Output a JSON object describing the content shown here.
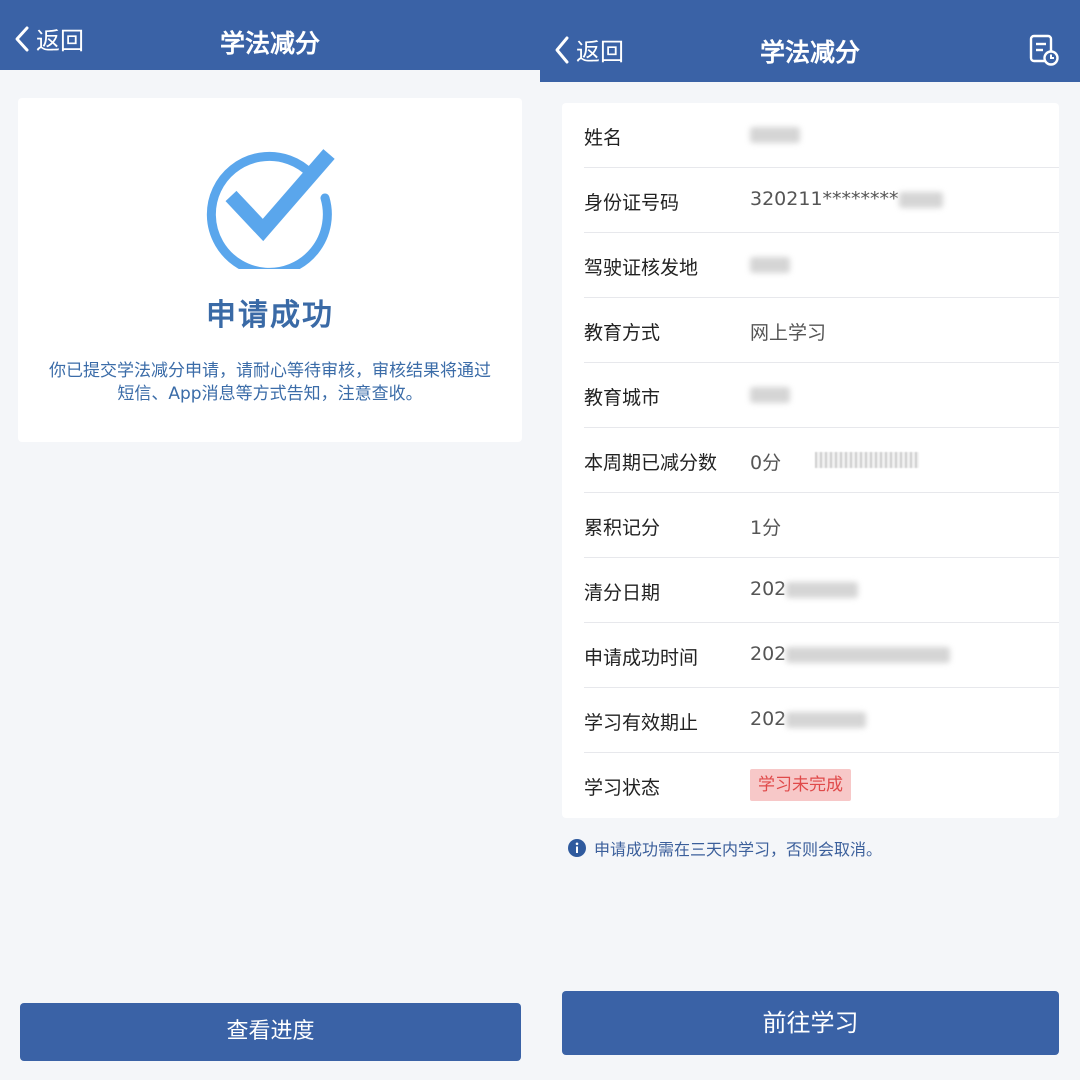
{
  "left": {
    "nav": {
      "back_label": "返回",
      "title": "学法减分"
    },
    "success": {
      "title": "申请成功",
      "desc": "你已提交学法减分申请，请耐心等待审核，审核结果将通过短信、App消息等方式告知，注意查收。"
    },
    "button_label": "查看进度"
  },
  "right": {
    "nav": {
      "back_label": "返回",
      "title": "学法减分",
      "record_icon": "record-clock-icon"
    },
    "rows": [
      {
        "label": "姓名",
        "value": ""
      },
      {
        "label": "身份证号码",
        "value": "320211********"
      },
      {
        "label": "驾驶证核发地",
        "value": ""
      },
      {
        "label": "教育方式",
        "value": "网上学习"
      },
      {
        "label": "教育城市",
        "value": ""
      },
      {
        "label": "本周期已减分数",
        "value": "0分"
      },
      {
        "label": "累积记分",
        "value": "1分"
      },
      {
        "label": "清分日期",
        "value": "202"
      },
      {
        "label": "申请成功时间",
        "value": "202"
      },
      {
        "label": "学习有效期止",
        "value": "202"
      },
      {
        "label": "学习状态",
        "value": "学习未完成"
      }
    ],
    "notice": "申请成功需在三天内学习，否则会取消。",
    "button_label": "前往学习"
  },
  "colors": {
    "nav_bg": "#3a62a6",
    "accent": "#3a6aa6",
    "status_bg": "#f7c8c8",
    "status_text": "#e04a4a"
  }
}
